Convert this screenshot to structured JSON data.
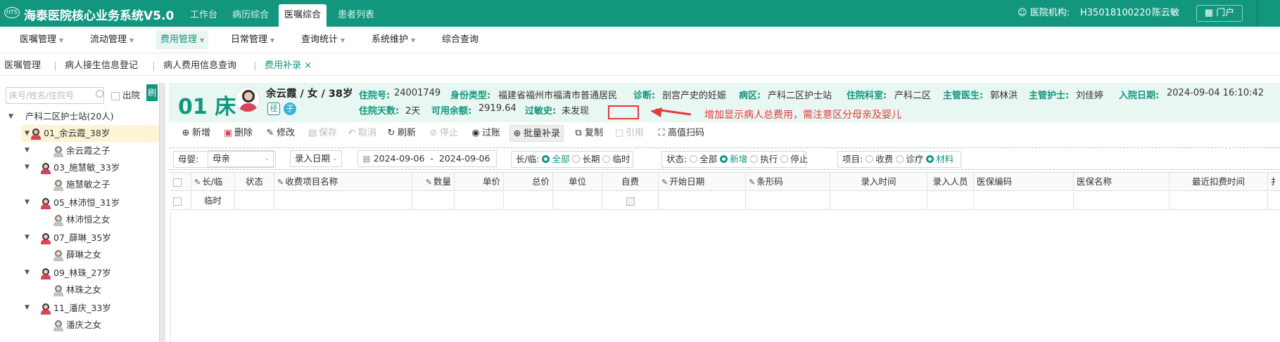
{
  "top": {
    "title": "海泰医院核心业务系统V5.0",
    "logo": "HTS",
    "tabs": [
      "工作台",
      "病历综合",
      "医嘱综合",
      "患者列表"
    ],
    "active_tab": "医嘱综合",
    "org_label": "医院机构:",
    "org_code": "H35018100220",
    "user": "陈云敏",
    "portal": "门户"
  },
  "menu": [
    "医嘱管理",
    "流动管理",
    "费用管理",
    "日常管理",
    "查询统计",
    "系统维护",
    "综合查询"
  ],
  "crumbs": [
    "医嘱管理",
    "病人接生信息登记",
    "病人费用信息查询",
    "费用补录"
  ],
  "sidebar": {
    "search_placeholder": "床号/姓名/住院号",
    "discharge": "出院",
    "btn": "刷",
    "root": "产科二区护士站(20人)",
    "items": [
      "01_余云霞_38岁",
      "余云霞之子",
      "03_施慧敏_33岁",
      "施慧敏之子",
      "05_林沛恒_31岁",
      "林沛恒之女",
      "07_薛琳_35岁",
      "薛琳之女",
      "09_林珠_27岁",
      "林珠之女",
      "11_潘庆_33岁",
      "潘庆之女"
    ]
  },
  "patient": {
    "bed": "01 床",
    "name": "余云霞 / 女 / 38岁",
    "tag_j": "径",
    "tag_z": "子",
    "fields": [
      {
        "l": "住院号:",
        "v": "24001749"
      },
      {
        "l": "身份类型:",
        "v": "福建省福州市福清市普通居民"
      },
      {
        "l": "诊断:",
        "v": "剖宫产史的妊娠"
      },
      {
        "l": "病区:",
        "v": "产科二区护士站"
      },
      {
        "l": "住院科室:",
        "v": "产科二区"
      },
      {
        "l": "主管医生:",
        "v": "郭林洪"
      },
      {
        "l": "主管护士:",
        "v": "刘佳婷"
      },
      {
        "l": "入院日期:",
        "v": "2024-09-04 16:10:42"
      },
      {
        "l": "住院天数:",
        "v": "2天"
      },
      {
        "l": "可用余额:",
        "v": "2919.64"
      },
      {
        "l": "过敏史:",
        "v": "未发现"
      }
    ],
    "note": "增加显示病人总费用，需注意区分母亲及婴儿"
  },
  "toolbar": [
    "新增",
    "删除",
    "修改",
    "保存",
    "取消",
    "刷新",
    "停止",
    "过账",
    "批量补录",
    "复制",
    "引用",
    "高值扫码"
  ],
  "filter": {
    "mb_label": "母婴:",
    "mb_value": "母亲",
    "date_type": "录入日期",
    "date_from": "2024-09-06",
    "date_sep": "-",
    "date_to": "2024-09-06",
    "cl_label": "长/临:",
    "cl_opts": [
      "全部",
      "长期",
      "临时"
    ],
    "st_label": "状态:",
    "st_opts": [
      "全部",
      "新增",
      "执行",
      "停止"
    ],
    "it_label": "项目:",
    "it_opts": [
      "收费",
      "诊疗",
      "材料"
    ]
  },
  "grid": {
    "headers": [
      "长/临",
      "状态",
      "收费项目名称",
      "数量",
      "单价",
      "总价",
      "单位",
      "自费",
      "开始日期",
      "条形码",
      "录入时间",
      "录入人员",
      "医保编码",
      "医保名称",
      "最近扣费时间",
      "扌"
    ],
    "row": {
      "cl": "临时"
    }
  },
  "colors": {
    "brand": "#12967e",
    "annotation": "#e23a3a"
  }
}
